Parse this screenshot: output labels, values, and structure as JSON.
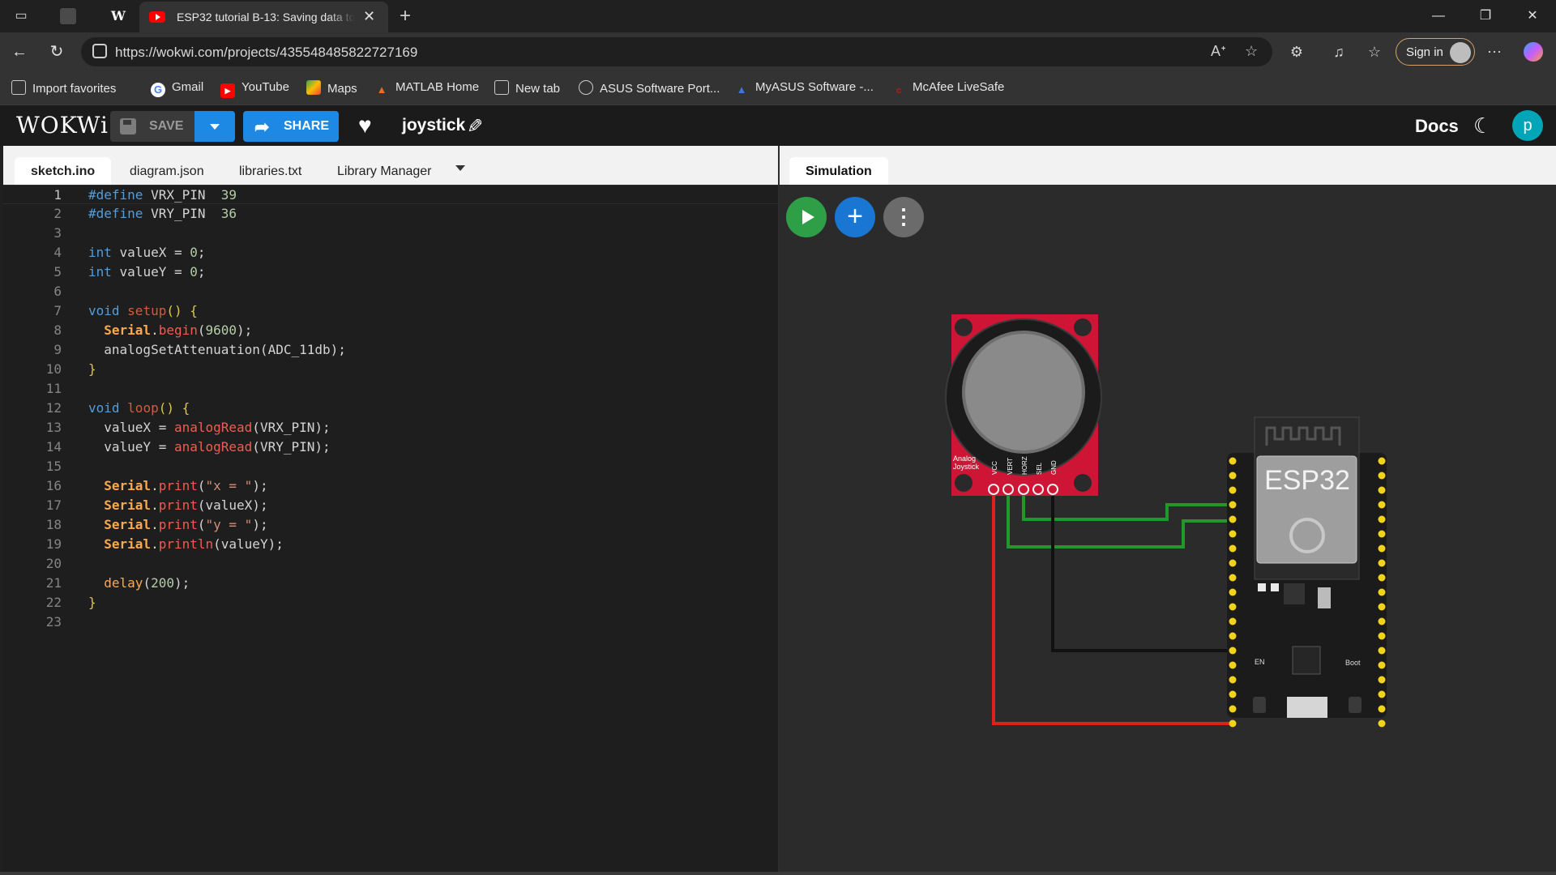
{
  "browser": {
    "active_tab_title": "ESP32 tutorial B-13: Saving data to",
    "url": "https://wokwi.com/projects/435548485822727169",
    "sign_in_label": "Sign in",
    "bookmarks": [
      {
        "label": "Import favorites",
        "icon": "import-icon"
      },
      {
        "label": "Gmail",
        "icon": "google-icon"
      },
      {
        "label": "YouTube",
        "icon": "youtube-icon"
      },
      {
        "label": "Maps",
        "icon": "maps-icon"
      },
      {
        "label": "MATLAB Home",
        "icon": "matlab-icon"
      },
      {
        "label": "New tab",
        "icon": "newtab-icon"
      },
      {
        "label": "ASUS Software Port...",
        "icon": "globe-icon"
      },
      {
        "label": "MyASUS Software -...",
        "icon": "myasus-icon"
      },
      {
        "label": "McAfee LiveSafe",
        "icon": "mcafee-icon"
      }
    ]
  },
  "wokwi": {
    "logo": "WOKWi",
    "save_label": "SAVE",
    "share_label": "SHARE",
    "project_name": "joystick",
    "docs_label": "Docs",
    "user_initial": "p",
    "accent_color": "#1e88e5"
  },
  "editor": {
    "tabs": [
      "sketch.ino",
      "diagram.json",
      "libraries.txt",
      "Library Manager"
    ],
    "active_tab": "sketch.ino",
    "line_numbers": [
      "1",
      "2",
      "3",
      "4",
      "5",
      "6",
      "7",
      "8",
      "9",
      "10",
      "11",
      "12",
      "13",
      "14",
      "15",
      "16",
      "17",
      "18",
      "19",
      "20",
      "21",
      "22",
      "23"
    ],
    "code": {
      "l1": {
        "a": "#define",
        "b": " VRX_PIN  ",
        "c": "39"
      },
      "l2": {
        "a": "#define",
        "b": " VRY_PIN  ",
        "c": "36"
      },
      "l4": {
        "a": "int",
        "b": " valueX = ",
        "c": "0",
        "d": ";"
      },
      "l5": {
        "a": "int",
        "b": " valueY = ",
        "c": "0",
        "d": ";"
      },
      "l7": {
        "a": "void",
        "b": " ",
        "c": "setup",
        "d": "() {"
      },
      "l8": {
        "a": "  ",
        "b": "Serial",
        "c": ".",
        "d": "begin",
        "e": "(",
        "f": "9600",
        "g": ");"
      },
      "l9": {
        "a": "  analogSetAttenuation",
        "b": "(",
        "c": "ADC_11db",
        "d": ");"
      },
      "l10": {
        "a": "}"
      },
      "l12": {
        "a": "void",
        "b": " ",
        "c": "loop",
        "d": "() {"
      },
      "l13": {
        "a": "  valueX = ",
        "b": "analogRead",
        "c": "(",
        "d": "VRX_PIN",
        "e": ");"
      },
      "l14": {
        "a": "  valueY = ",
        "b": "analogRead",
        "c": "(",
        "d": "VRY_PIN",
        "e": ");"
      },
      "l16": {
        "a": "  ",
        "b": "Serial",
        "c": ".",
        "d": "print",
        "e": "(",
        "f": "\"x = \"",
        "g": ");"
      },
      "l17": {
        "a": "  ",
        "b": "Serial",
        "c": ".",
        "d": "print",
        "e": "(valueX);"
      },
      "l18": {
        "a": "  ",
        "b": "Serial",
        "c": ".",
        "d": "print",
        "e": "(",
        "f": "\"y = \"",
        "g": ");"
      },
      "l19": {
        "a": "  ",
        "b": "Serial",
        "c": ".",
        "d": "println",
        "e": "(valueY);"
      },
      "l21": {
        "a": "  ",
        "b": "delay",
        "c": "(",
        "d": "200",
        "e": ");"
      },
      "l22": {
        "a": "}"
      }
    }
  },
  "simulation": {
    "tab_label": "Simulation",
    "joystick_label_1": "Analog",
    "joystick_label_2": "Joystick",
    "joystick_pins": [
      "VCC",
      "VERT",
      "HORZ",
      "SEL",
      "GND"
    ],
    "board_label": "ESP32",
    "board_en_label": "EN",
    "board_boot_label": "Boot",
    "wire_colors": {
      "power": "#e0201b",
      "signal": "#1f9a2a",
      "ground": "#111111"
    }
  }
}
